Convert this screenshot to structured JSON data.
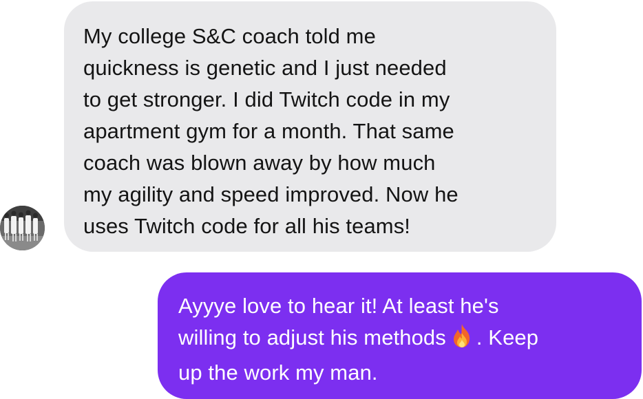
{
  "conversation": {
    "incoming": {
      "sender_icon": "avatar-team-photo",
      "lines": [
        "My college S&C coach told me",
        "quickness is genetic and I just needed",
        "to get stronger. I did Twitch code in my",
        "apartment gym for a month. That same",
        "coach was blown away by how much",
        "my agility and speed improved. Now he",
        "uses Twitch code for all his teams!"
      ]
    },
    "outgoing": {
      "line1": "Ayyye love to hear it! At least he's",
      "line2_before_emoji": "willing to adjust his methods",
      "emoji": "fire-emoji",
      "line2_after_emoji": ". Keep",
      "line3": "up the work my man."
    }
  },
  "colors": {
    "incoming_bubble": "#e9e9eb",
    "incoming_text": "#141414",
    "outgoing_bubble": "#7c2ff0",
    "outgoing_text": "#ffffff"
  }
}
